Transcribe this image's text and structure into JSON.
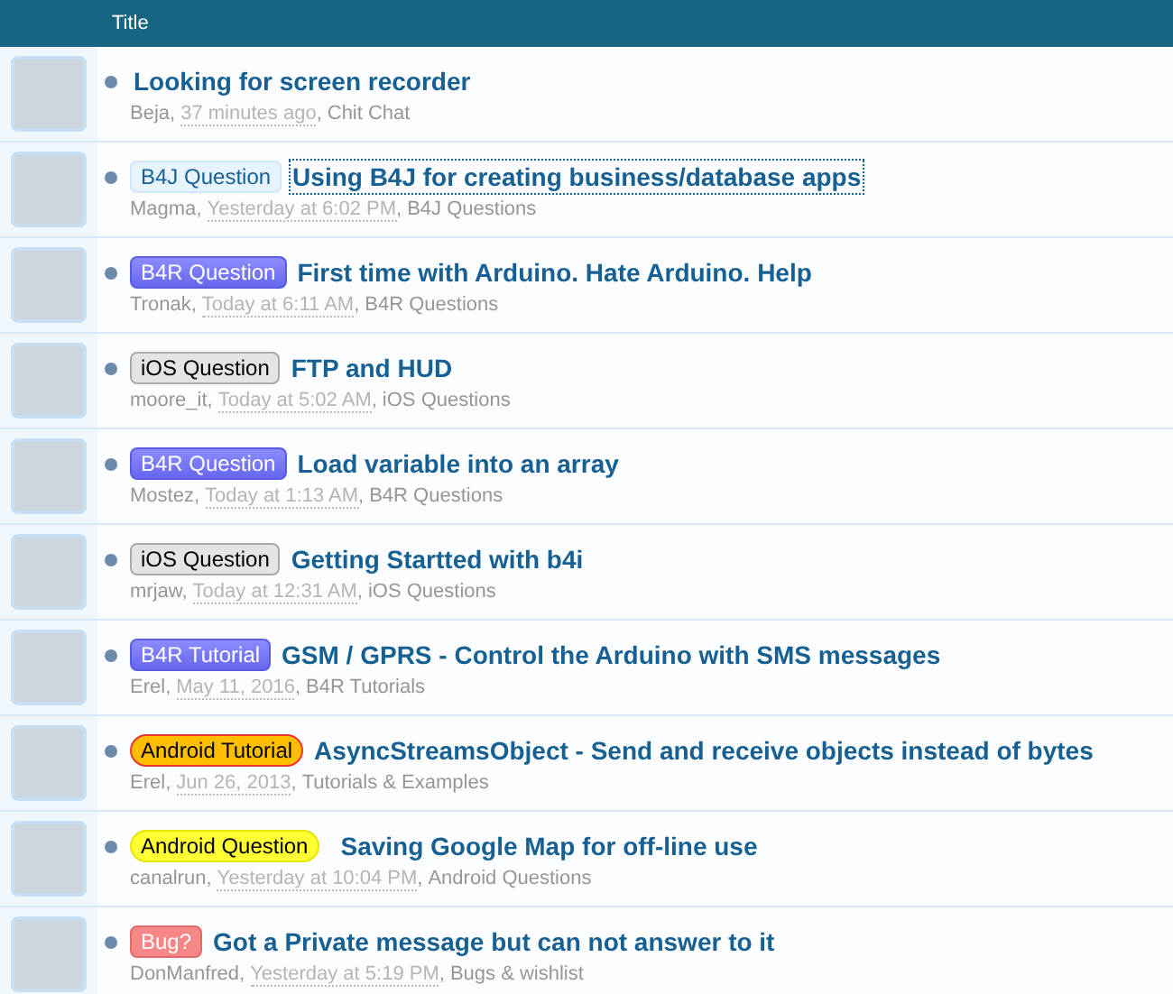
{
  "header": {
    "title": "Title"
  },
  "threads": [
    {
      "title": "Looking for screen recorder",
      "author": "Beja",
      "date": "37 minutes ago",
      "forum": "Chit Chat",
      "separators": [
        ",",
        ","
      ],
      "focused": false
    },
    {
      "prefix": {
        "label": "B4J Question",
        "kind": "b4j"
      },
      "title": "Using B4J for creating business/database apps",
      "author": "Magma",
      "date": "Yesterday at 6:02 PM",
      "forum": "B4J Questions",
      "separators": [
        ",",
        ","
      ],
      "focused": true
    },
    {
      "prefix": {
        "label": "B4R Question",
        "kind": "b4r"
      },
      "title": "First time with Arduino. Hate Arduino. Help",
      "author": "Tronak",
      "date": "Today at 6:11 AM",
      "forum": "B4R Questions",
      "separators": [
        ",",
        ","
      ],
      "focused": false
    },
    {
      "prefix": {
        "label": "iOS Question",
        "kind": "ios"
      },
      "title": "FTP and HUD",
      "author": "moore_it",
      "date": "Today at 5:02 AM",
      "forum": "iOS Questions",
      "separators": [
        ",",
        ","
      ],
      "focused": false
    },
    {
      "prefix": {
        "label": "B4R Question",
        "kind": "b4r"
      },
      "title": "Load variable into an array",
      "author": "Mostez",
      "date": "Today at 1:13 AM",
      "forum": "B4R Questions",
      "separators": [
        ",",
        ","
      ],
      "focused": false
    },
    {
      "prefix": {
        "label": "iOS Question",
        "kind": "ios"
      },
      "title": "Getting Startted with b4i",
      "author": "mrjaw",
      "date": "Today at 12:31 AM",
      "forum": "iOS Questions",
      "separators": [
        ",",
        ","
      ],
      "focused": false
    },
    {
      "prefix": {
        "label": "B4R Tutorial",
        "kind": "b4r"
      },
      "title": "GSM / GPRS - Control the Arduino with SMS messages",
      "author": "Erel",
      "date": "May 11, 2016",
      "forum": "B4R Tutorials",
      "separators": [
        ",",
        ","
      ],
      "focused": false
    },
    {
      "prefix": {
        "label": "Android Tutorial",
        "kind": "android-tutorial"
      },
      "title": "AsyncStreamsObject - Send and receive objects instead of bytes",
      "author": "Erel",
      "date": "Jun 26, 2013",
      "forum": "Tutorials & Examples",
      "separators": [
        ",",
        ","
      ],
      "focused": false
    },
    {
      "prefix": {
        "label": "Android Question",
        "kind": "android-question"
      },
      "title": "Saving Google Map for off-line use",
      "author": "canalrun",
      "date": "Yesterday at 10:04 PM",
      "forum": "Android Questions",
      "separators": [
        ",",
        ","
      ],
      "focused": false
    },
    {
      "prefix": {
        "label": "Bug?",
        "kind": "bug"
      },
      "title": "Got a Private message but can not answer to it",
      "author": "DonManfred",
      "date": "Yesterday at 5:19 PM",
      "forum": "Bugs & wishlist",
      "separators": [
        ",",
        ","
      ],
      "focused": false
    }
  ]
}
